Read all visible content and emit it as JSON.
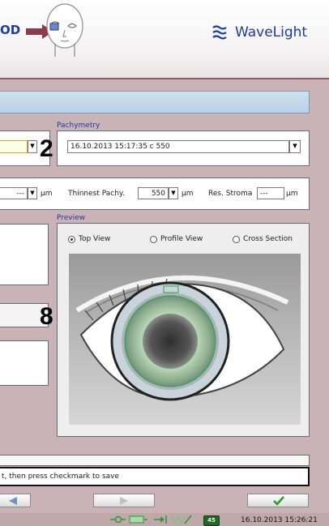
{
  "header": {
    "eye_label": "OD",
    "brand_name": "WaveLight",
    "head_icon": "patient-head-icon",
    "brand_icon": "wavelight-logo-icon"
  },
  "steps": {
    "step_2": "2",
    "step_8": "8"
  },
  "pachymetry": {
    "label": "Pachymetry",
    "selected": "16.10.2013 15:17:35    c 550"
  },
  "left_combo": {
    "value": ""
  },
  "measurements": {
    "left_value": "---",
    "left_unit": "µm",
    "thinnest_label": "Thinnest Pachy.",
    "thinnest_value": "550",
    "thinnest_unit": "µm",
    "res_stroma_label": "Res. Stroma",
    "res_stroma_value": "---",
    "res_stroma_unit": "µm"
  },
  "preview": {
    "label": "Preview",
    "views": [
      {
        "label": "Top View",
        "selected": true
      },
      {
        "label": "Profile View",
        "selected": false
      },
      {
        "label": "Cross Section",
        "selected": false
      }
    ]
  },
  "instruction": {
    "text": "t, then press checkmark to save"
  },
  "buttons": {
    "back_icon": "arrow-left-icon",
    "play_icon": "play-icon",
    "confirm_icon": "checkmark-icon"
  },
  "status": {
    "count": "45",
    "datetime": "16.10.2013 15:26:21"
  },
  "colors": {
    "accent_blue": "#1f3aa0",
    "arrow_red": "#8e3a4a",
    "background": "#c9b3b6",
    "confirm_green": "#2f9a2f"
  }
}
